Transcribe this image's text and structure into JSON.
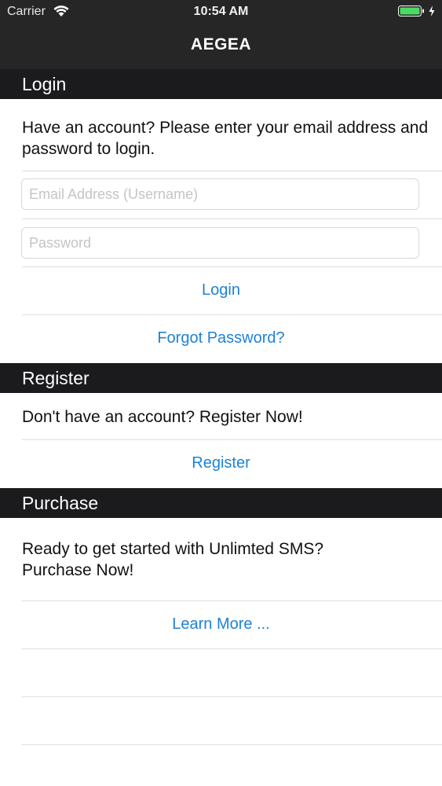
{
  "status_bar": {
    "carrier": "Carrier",
    "time": "10:54 AM",
    "battery_color": "#4cd964"
  },
  "nav": {
    "title": "AEGEA"
  },
  "login": {
    "header": "Login",
    "prompt": "Have an account? Please enter your email address and password to login.",
    "email_placeholder": "Email Address (Username)",
    "password_placeholder": "Password",
    "login_label": "Login",
    "forgot_label": "Forgot Password?"
  },
  "register": {
    "header": "Register",
    "prompt": "Don't have an account? Register Now!",
    "register_label": "Register"
  },
  "purchase": {
    "header": "Purchase",
    "prompt": "Ready to get started with Unlimted SMS? Purchase Now!",
    "learn_more_label": "Learn More ..."
  },
  "colors": {
    "accent": "#1c82d8",
    "header_bg": "#1b1b1d",
    "nav_bg": "#262626"
  }
}
